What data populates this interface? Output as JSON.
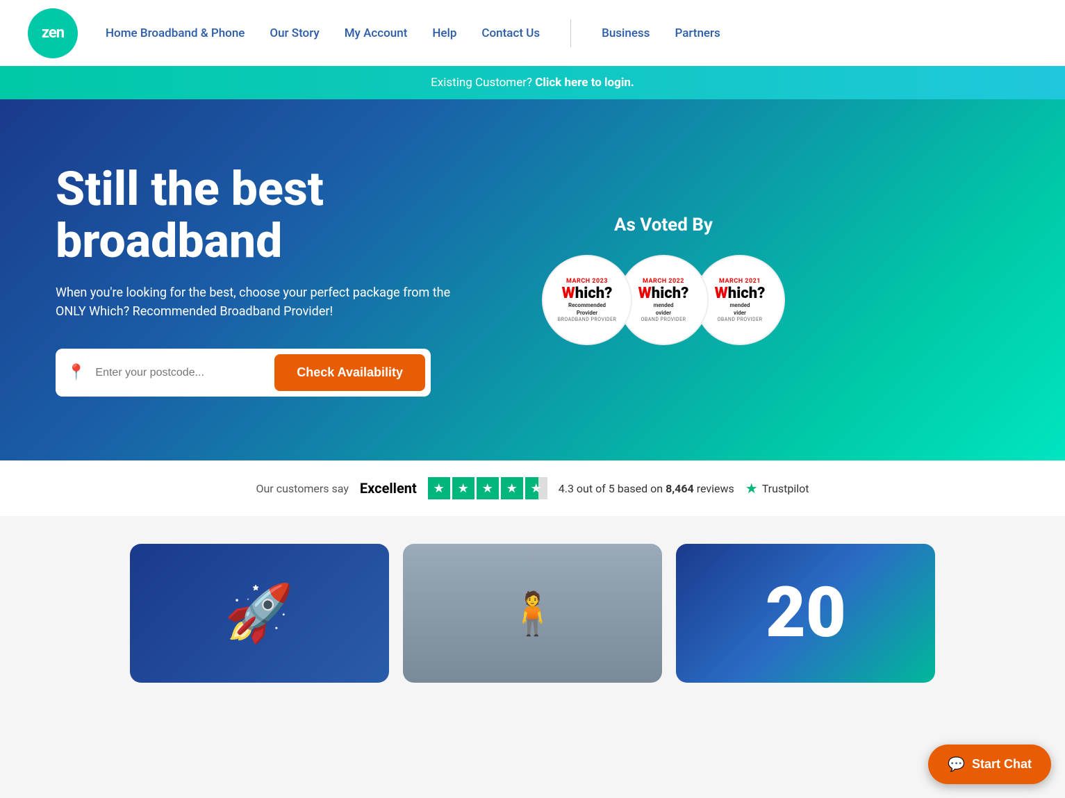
{
  "header": {
    "logo_text": "zen",
    "nav_main": [
      {
        "label": "Home Broadband & Phone",
        "id": "home-broadband"
      },
      {
        "label": "Our Story",
        "id": "our-story"
      },
      {
        "label": "My Account",
        "id": "my-account"
      },
      {
        "label": "Help",
        "id": "help"
      },
      {
        "label": "Contact Us",
        "id": "contact-us"
      }
    ],
    "nav_secondary": [
      {
        "label": "Business",
        "id": "business"
      },
      {
        "label": "Partners",
        "id": "partners"
      }
    ]
  },
  "announcement": {
    "text": "Existing Customer?",
    "link_text": "Click here to login."
  },
  "hero": {
    "title": "Still the best broadband",
    "subtitle": "When you're looking for the best, choose your perfect package from the ONLY Which? Recommended Broadband Provider!",
    "search_placeholder": "Enter your postcode...",
    "check_btn_label": "Check Availability",
    "as_voted_title": "As Voted By",
    "badges": [
      {
        "date": "MARCH 2023",
        "which": "Which?",
        "label": "Recommended Provider",
        "sub": "BROADBAND PROVIDER"
      },
      {
        "date": "MARCH 2022",
        "which": "Which?",
        "label": "mended\novider",
        "sub": "OBAND PROVIDER"
      },
      {
        "date": "MARCH 2021",
        "which": "Which?",
        "label": "mended\nvider",
        "sub": "OBAND PROVIDER"
      }
    ]
  },
  "trustpilot": {
    "label": "Our customers say",
    "rating_word": "Excellent",
    "score": "4.3",
    "out_of": "5",
    "review_count": "8,464",
    "review_label": "reviews",
    "brand": "Trustpilot"
  },
  "cards": [
    {
      "type": "blue",
      "icon": "🚀"
    },
    {
      "type": "photo",
      "icon": "🧍"
    },
    {
      "type": "number",
      "text": "20"
    }
  ],
  "chat": {
    "label": "Start Chat"
  }
}
